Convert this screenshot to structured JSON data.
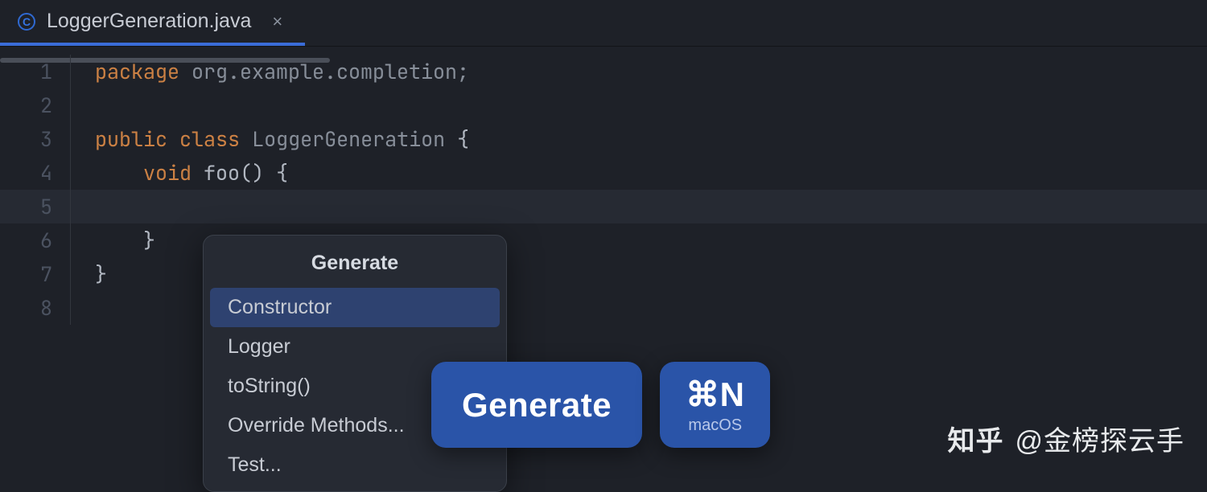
{
  "tab": {
    "label": "LoggerGeneration.java",
    "icon_letter": "C"
  },
  "editor": {
    "line_count": 8,
    "tokens": {
      "l1": {
        "kw": "package",
        "rest": " org.example.completion;"
      },
      "l3_kw1": "public",
      "l3_kw2": "class",
      "l3_ident": "LoggerGeneration",
      "l3_brace": " {",
      "l4_kw": "void",
      "l4_name": "foo",
      "l4_after": "() {",
      "l6": "    }",
      "l7": "}"
    }
  },
  "popup": {
    "title": "Generate",
    "items": [
      "Constructor",
      "Logger",
      "toString()",
      "Override Methods...",
      "Test..."
    ],
    "selected_index": 0
  },
  "hint": {
    "action": "Generate",
    "shortcut": "⌘N",
    "os": "macOS"
  },
  "watermark": {
    "site": "知乎",
    "author": "@金榜探云手"
  }
}
